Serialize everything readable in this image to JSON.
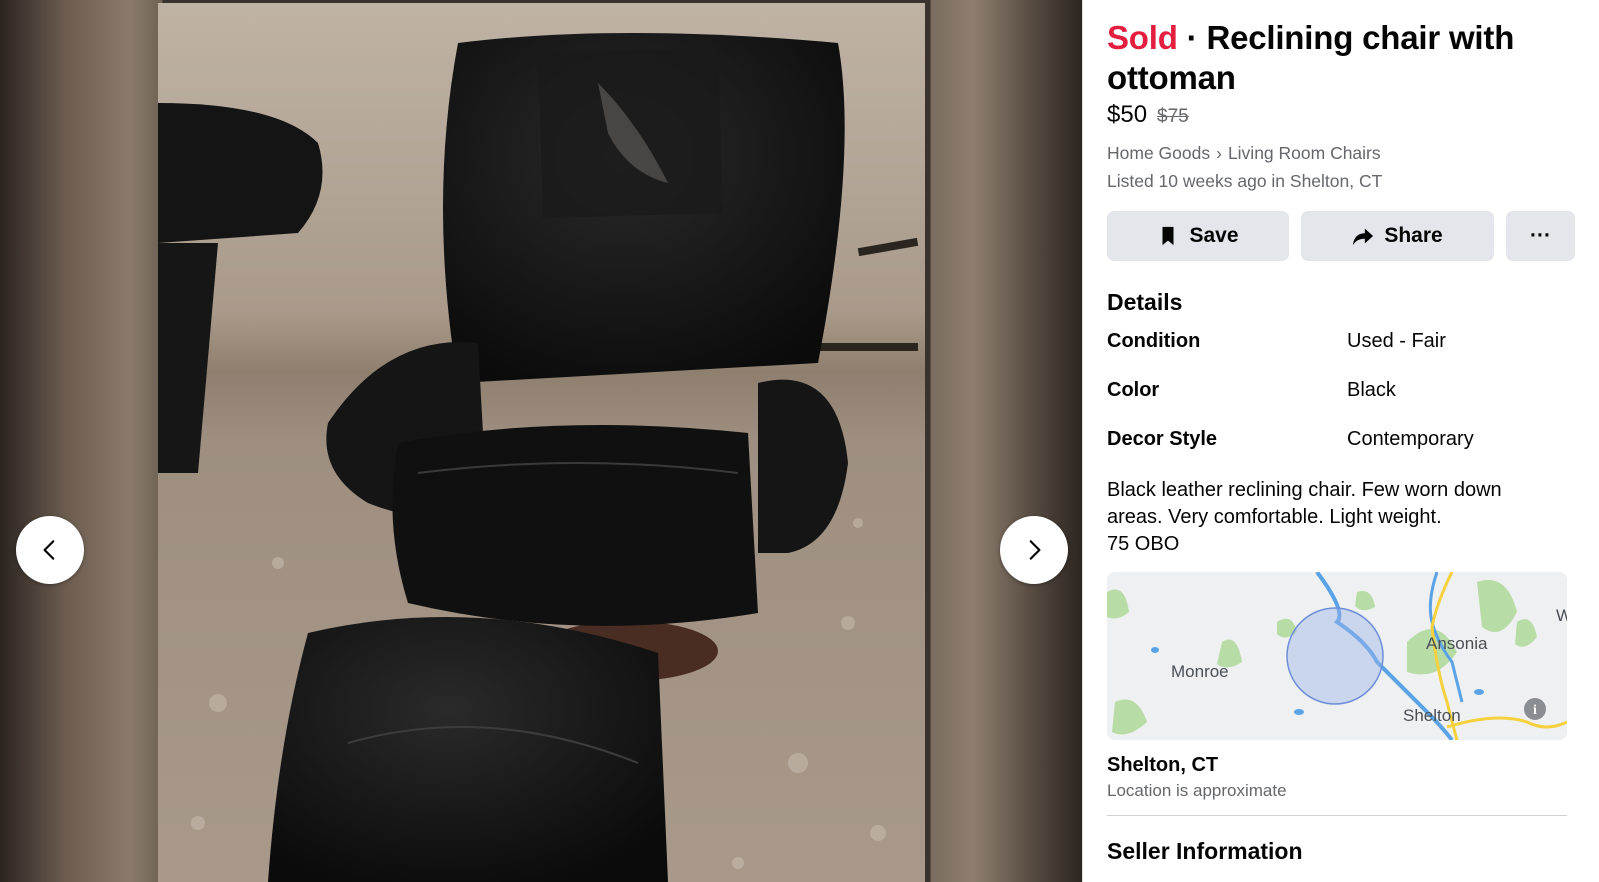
{
  "listing": {
    "status": "Sold",
    "separator": " · ",
    "title": "Reclining chair with ottoman",
    "price": "$50",
    "original_price": "$75",
    "breadcrumb": [
      "Home Goods",
      "›",
      "Living Room Chairs"
    ],
    "listed": "Listed 10 weeks ago in Shelton, CT"
  },
  "actions": {
    "save_label": "Save",
    "share_label": "Share",
    "more_label": "···"
  },
  "details": {
    "heading": "Details",
    "rows": [
      {
        "key": "Condition",
        "value": "Used - Fair"
      },
      {
        "key": "Color",
        "value": "Black"
      },
      {
        "key": "Decor Style",
        "value": "Contemporary"
      }
    ],
    "description": "Black leather reclining chair. Few worn down\nareas. Very comfortable. Light weight.\n75 OBO"
  },
  "map": {
    "labels": [
      "Monroe",
      "Ansonia",
      "Shelton"
    ],
    "edge_letter": "W",
    "info_icon": "i"
  },
  "location": {
    "name": "Shelton, CT",
    "note": "Location is approximate"
  },
  "seller": {
    "heading": "Seller Information"
  },
  "colors": {
    "sold": "#e41e3f",
    "button_bg": "#e4e6eb",
    "secondary_text": "#65676b"
  },
  "icons": {
    "prev": "chevron-left-icon",
    "next": "chevron-right-icon",
    "save": "bookmark-icon",
    "share": "share-arrow-icon",
    "more": "ellipsis-icon",
    "info": "info-icon"
  }
}
